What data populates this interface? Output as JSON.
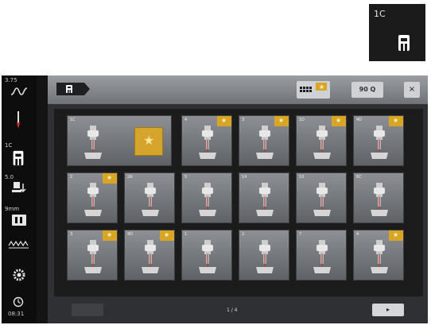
{
  "badge": {
    "label": "1C",
    "icon": "presser-foot-icon"
  },
  "sidebar": {
    "top_value": "3.75",
    "foot_label": "1C",
    "tension_value": "5.0",
    "length_value": "9mm",
    "time": "08:31",
    "icons": [
      "thread-tension-icon",
      "needle-icon",
      "presser-foot-icon",
      "foot-pressure-icon",
      "stitch-plate-icon",
      "feed-dog-icon",
      "settings-icon",
      "clock-icon"
    ]
  },
  "header": {
    "tab_icon": "presser-foot-icon",
    "grid_icon": "grid-favorites-icon",
    "search_label": "90 Q",
    "close_label": "×"
  },
  "tiles": [
    {
      "num": "1C",
      "fav": false
    },
    {
      "num": "4",
      "fav": true
    },
    {
      "num": "3",
      "fav": true
    },
    {
      "num": "1D",
      "fav": true
    },
    {
      "num": "4D",
      "fav": true
    },
    {
      "num": "2",
      "fav": true
    },
    {
      "num": "2A",
      "fav": false
    },
    {
      "num": "5",
      "fav": false
    },
    {
      "num": "14",
      "fav": false
    },
    {
      "num": "10",
      "fav": false
    },
    {
      "num": "6C",
      "fav": false
    },
    {
      "num": "3",
      "fav": true
    },
    {
      "num": "4D",
      "fav": true
    },
    {
      "num": "1",
      "fav": false
    },
    {
      "num": "2",
      "fav": false
    },
    {
      "num": "7",
      "fav": false
    },
    {
      "num": "4",
      "fav": true
    }
  ],
  "footer": {
    "page": "1 / 4",
    "next": "▸"
  },
  "colors": {
    "accent": "#d8a624",
    "panel": "#2e3033"
  }
}
